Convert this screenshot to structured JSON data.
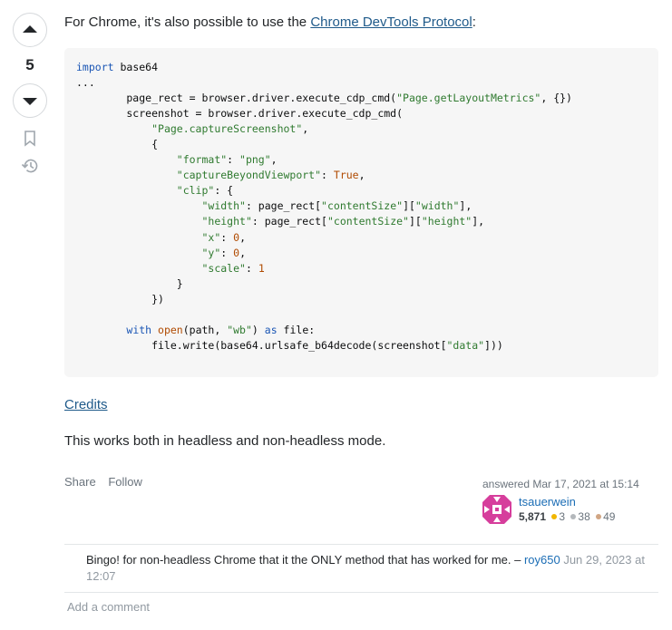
{
  "vote": {
    "count": "5",
    "up_icon": "arrow-up-icon",
    "down_icon": "arrow-down-icon",
    "bookmark_icon": "bookmark-icon",
    "history_icon": "history-icon"
  },
  "answer": {
    "intro_prefix": "For Chrome, it's also possible to use the ",
    "intro_link": "Chrome DevTools Protocol",
    "intro_suffix": ":",
    "credits_link": "Credits",
    "body": "This works both in headless and non-headless mode."
  },
  "menu": {
    "share": "Share",
    "follow": "Follow"
  },
  "signature": {
    "action": "answered Mar 17, 2021 at 15:14",
    "username": "tsauerwein",
    "reputation": "5,871",
    "gold": "3",
    "silver": "38",
    "bronze": "49"
  },
  "comments": [
    {
      "text": "Bingo! for non-headless Chrome that it the ONLY method that has worked for me. – ",
      "user": "roy650",
      "date": "Jun 29, 2023 at 12:07"
    }
  ],
  "add_comment": "Add a comment",
  "colors": {
    "link": "#1b6db5",
    "code_bg": "#f6f6f6",
    "keyword": "#1b56b5",
    "string": "#2f7a2f",
    "literal": "#b04a00",
    "gold": "#f1b600",
    "silver": "#b4b8bc",
    "bronze": "#d1a684",
    "avatar": "#d63e9c"
  }
}
